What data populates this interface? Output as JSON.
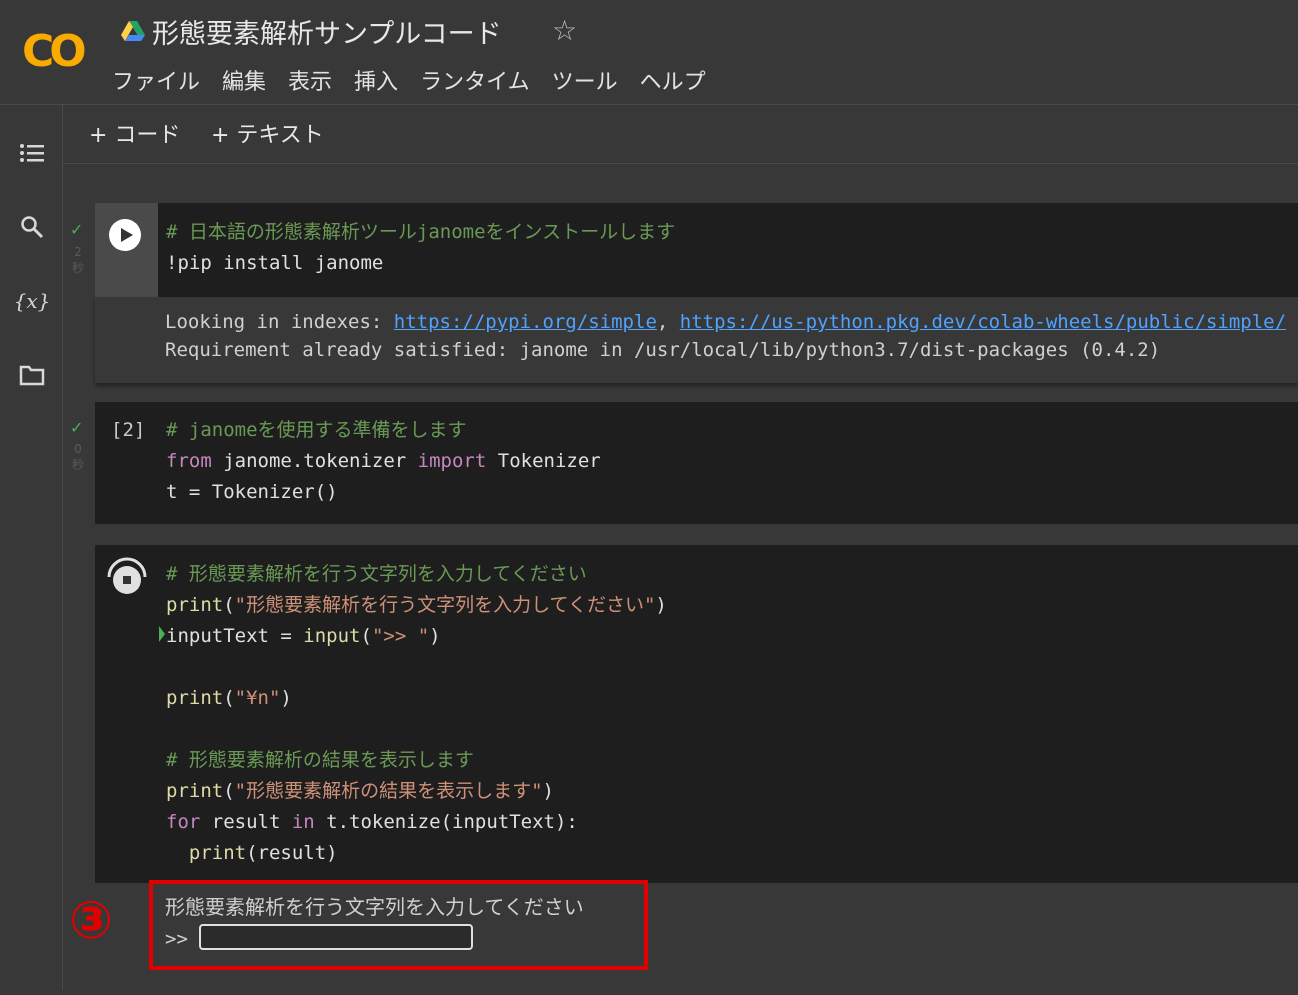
{
  "header": {
    "app_logo": "CO",
    "title": "形態要素解析サンプルコード",
    "menu": [
      "ファイル",
      "編集",
      "表示",
      "挿入",
      "ランタイム",
      "ツール",
      "ヘルプ"
    ]
  },
  "toolbar": {
    "add_code": "+ コード",
    "add_text": "+ テキスト"
  },
  "cells": [
    {
      "status": "✓",
      "time": [
        "2",
        "秒"
      ],
      "code": [
        "# 日本語の形態素解析ツールjanomeをインストールします",
        "!pip install janome"
      ],
      "output": {
        "prefix": "Looking in indexes: ",
        "link1": "https://pypi.org/simple",
        "sep": ", ",
        "link2": "https://us-python.pkg.dev/colab-wheels/public/simple/",
        "line2": "Requirement already satisfied: janome in /usr/local/lib/python3.7/dist-packages (0.4.2)"
      }
    },
    {
      "status": "✓",
      "time": [
        "0",
        "秒"
      ],
      "exec_count": "[2]",
      "code": [
        "# janomeを使用する準備をします",
        "from",
        " janome.tokenizer ",
        "import",
        " Tokenizer",
        "t = Tokenizer()"
      ]
    },
    {
      "code": [
        "# 形態要素解析を行う文字列を入力してください",
        "print",
        "(",
        "\"形態要素解析を行う文字列を入力してください\"",
        ")",
        "inputText = ",
        "input",
        "(",
        "\">> \"",
        ")",
        "print",
        "(",
        "\"¥n\"",
        ")",
        "# 形態要素解析の結果を表示します",
        "print",
        "(",
        "\"形態要素解析の結果を表示します\"",
        ")",
        "for",
        " result ",
        "in",
        " t.tokenize(inputText):",
        "print",
        "(result)"
      ],
      "output": {
        "prompt_text": "形態要素解析を行う文字列を入力してください",
        "input_prompt": ">>",
        "input_value": ""
      }
    }
  ],
  "annotation": {
    "step_number": "③",
    "color": "#e00000"
  }
}
